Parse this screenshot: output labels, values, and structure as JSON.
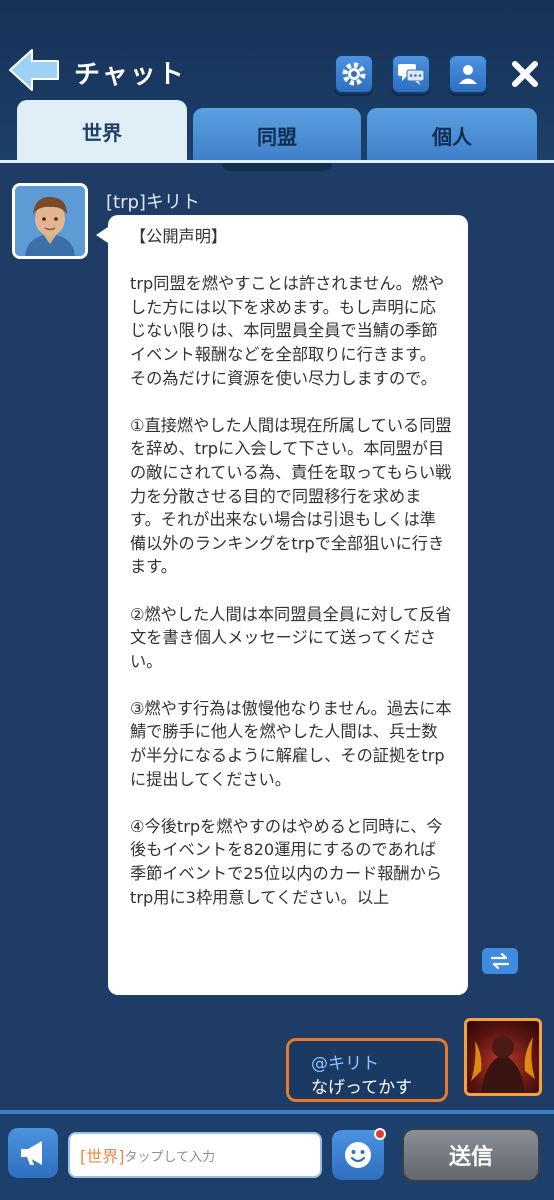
{
  "header": {
    "title": "チャット",
    "icons": [
      "back-arrow-icon",
      "gear-icon",
      "chat-bubbles-icon",
      "profile-icon",
      "close-icon"
    ]
  },
  "tabs": [
    {
      "label": "世界",
      "active": true
    },
    {
      "label": "同盟",
      "active": false
    },
    {
      "label": "個人",
      "active": false
    }
  ],
  "messages": {
    "first": {
      "sender": "[trp]キリト",
      "text": "【公開声明】\n\ntrp同盟を燃やすことは許されません。燃やした方には以下を求めます。もし声明に応じない限りは、本同盟員全員で当鯖の季節イベント報酬などを全部取りに行きます。その為だけに資源を使い尽力しますので。\n\n①直接燃やした人間は現在所属している同盟を辞め、trpに入会して下さい。本同盟が目の敵にされている為、責任を取ってもらい戦力を分散させる目的で同盟移行を求めます。それが出来ない場合は引退もしくは準備以外のランキングをtrpで全部狙いに行きます。\n\n②燃やした人間は本同盟員全員に対して反省文を書き個人メッセージにて送ってください。\n\n③燃やす行為は傲慢他なりません。過去に本鯖で勝手に他人を燃やした人間は、兵士数が半分になるように解雇し、その証拠をtrpに提出してください。\n\n④今後trpを燃やすのはやめると同時に、今後もイベントを820運用にするのであれば季節イベントで25位以内のカード報酬からtrp用に3枠用意してください。以上"
    },
    "reply": {
      "mention": "@キリト",
      "text": "なげってかす"
    }
  },
  "input": {
    "channel": "[世界]",
    "placeholder": "タップして入力"
  },
  "send_label": "送信",
  "colors": {
    "background": "#1e3c66",
    "accent": "#3f8be0",
    "reply_border": "#e8792a"
  }
}
